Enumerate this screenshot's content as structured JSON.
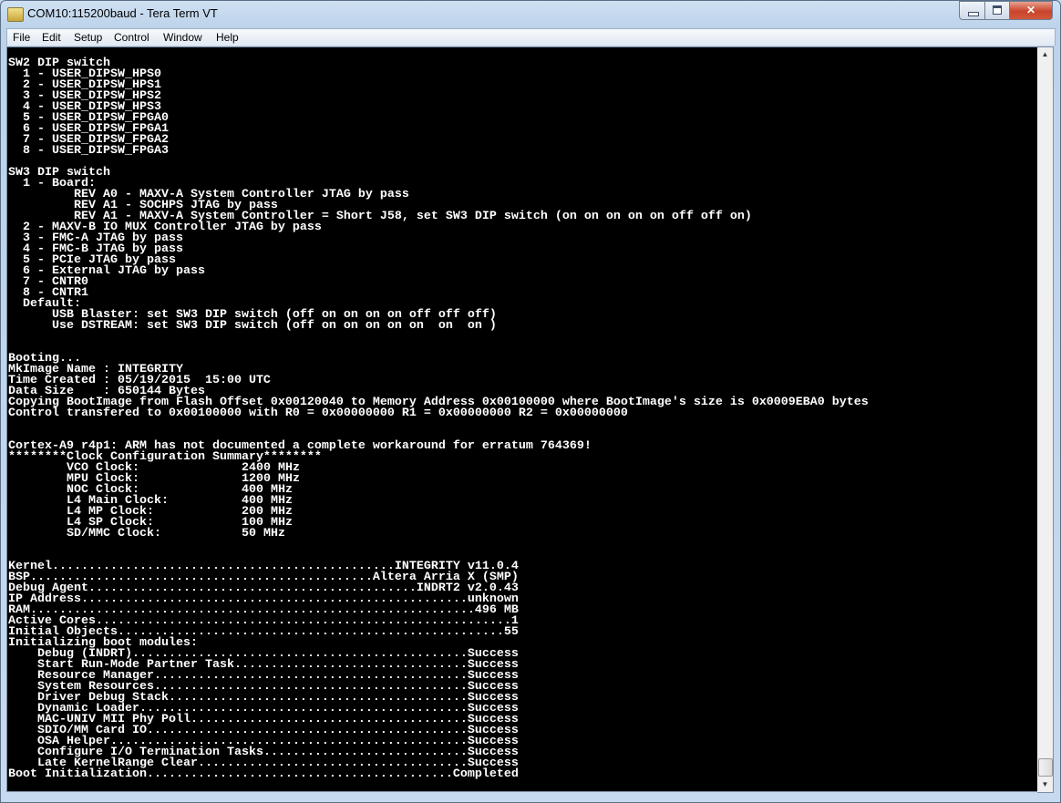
{
  "window": {
    "title": "COM10:115200baud - Tera Term VT"
  },
  "menu": [
    "File",
    "Edit",
    "Setup",
    "Control",
    "Window",
    "Help"
  ],
  "terminal": {
    "lines": [
      "SW2 DIP switch",
      "  1 - USER_DIPSW_HPS0",
      "  2 - USER_DIPSW_HPS1",
      "  3 - USER_DIPSW_HPS2",
      "  4 - USER_DIPSW_HPS3",
      "  5 - USER_DIPSW_FPGA0",
      "  6 - USER_DIPSW_FPGA1",
      "  7 - USER_DIPSW_FPGA2",
      "  8 - USER_DIPSW_FPGA3",
      "",
      "SW3 DIP switch",
      "  1 - Board:",
      "         REV A0 - MAXV-A System Controller JTAG by pass",
      "         REV A1 - SOCHPS JTAG by pass",
      "         REV A1 - MAXV-A System Controller = Short J58, set SW3 DIP switch (on on on on on off off on)",
      "  2 - MAXV-B IO MUX Controller JTAG by pass",
      "  3 - FMC-A JTAG by pass",
      "  4 - FMC-B JTAG by pass",
      "  5 - PCIe JTAG by pass",
      "  6 - External JTAG by pass",
      "  7 - CNTR0",
      "  8 - CNTR1",
      "  Default:",
      "      USB Blaster: set SW3 DIP switch (off on on on on off off off)",
      "      Use DSTREAM: set SW3 DIP switch (off on on on on on  on  on )",
      "",
      "",
      "Booting...",
      "MkImage Name : INTEGRITY",
      "Time Created : 05/19/2015  15:00 UTC",
      "Data Size    : 650144 Bytes",
      "Copying BootImage from Flash Offset 0x00120040 to Memory Address 0x00100000 where BootImage's size is 0x0009EBA0 bytes",
      "Control transfered to 0x00100000 with R0 = 0x00000000 R1 = 0x00000000 R2 = 0x00000000",
      "",
      "",
      "Cortex-A9 r4p1: ARM has not documented a complete workaround for erratum 764369!",
      "********Clock Configuration Summary********",
      {
        "type": "col",
        "indent": 8,
        "label": "VCO Clock:",
        "value": "2400 MHz"
      },
      {
        "type": "col",
        "indent": 8,
        "label": "MPU Clock:",
        "value": "1200 MHz"
      },
      {
        "type": "col",
        "indent": 8,
        "label": "NOC Clock:",
        "value": "400 MHz"
      },
      {
        "type": "col",
        "indent": 8,
        "label": "L4 Main Clock:",
        "value": "400 MHz"
      },
      {
        "type": "col",
        "indent": 8,
        "label": "L4 MP Clock:",
        "value": "200 MHz"
      },
      {
        "type": "col",
        "indent": 8,
        "label": "L4 SP Clock:",
        "value": "100 MHz"
      },
      {
        "type": "col",
        "indent": 8,
        "label": "SD/MMC Clock:",
        "value": "50 MHz"
      },
      "",
      "",
      {
        "type": "dots",
        "indent": 0,
        "label": "Kernel",
        "value": "INTEGRITY v11.0.4"
      },
      {
        "type": "dots",
        "indent": 0,
        "label": "BSP",
        "value": "Altera Arria X (SMP)"
      },
      {
        "type": "dots",
        "indent": 0,
        "label": "Debug Agent",
        "value": "INDRT2 v2.0.43"
      },
      {
        "type": "dots",
        "indent": 0,
        "label": "IP Address",
        "value": "unknown"
      },
      {
        "type": "dots",
        "indent": 0,
        "label": "RAM",
        "value": "496 MB"
      },
      {
        "type": "dots",
        "indent": 0,
        "label": "Active Cores",
        "value": "1"
      },
      {
        "type": "dots",
        "indent": 0,
        "label": "Initial Objects",
        "value": "55"
      },
      "Initializing boot modules:",
      {
        "type": "dots",
        "indent": 4,
        "label": "Debug (INDRT)",
        "value": "Success"
      },
      {
        "type": "dots",
        "indent": 4,
        "label": "Start Run-Mode Partner Task",
        "value": "Success"
      },
      {
        "type": "dots",
        "indent": 4,
        "label": "Resource Manager",
        "value": "Success"
      },
      {
        "type": "dots",
        "indent": 4,
        "label": "System Resources",
        "value": "Success"
      },
      {
        "type": "dots",
        "indent": 4,
        "label": "Driver Debug Stack",
        "value": "Success"
      },
      {
        "type": "dots",
        "indent": 4,
        "label": "Dynamic Loader",
        "value": "Success"
      },
      {
        "type": "dots",
        "indent": 4,
        "label": "MAC-UNIV MII Phy Poll",
        "value": "Success"
      },
      {
        "type": "dots",
        "indent": 4,
        "label": "SDIO/MM Card IO",
        "value": "Success"
      },
      {
        "type": "dots",
        "indent": 4,
        "label": "OSA Helper",
        "value": "Success"
      },
      {
        "type": "dots",
        "indent": 4,
        "label": "Configure I/O Termination Tasks",
        "value": "Success"
      },
      {
        "type": "dots",
        "indent": 4,
        "label": "Late KernelRange Clear",
        "value": "Success"
      },
      {
        "type": "dots",
        "indent": 0,
        "label": "Boot Initialization",
        "value": "Completed"
      }
    ]
  },
  "colors": {
    "terminal_bg": "#000000",
    "terminal_fg": "#ffffff",
    "close": "#c9442a"
  }
}
